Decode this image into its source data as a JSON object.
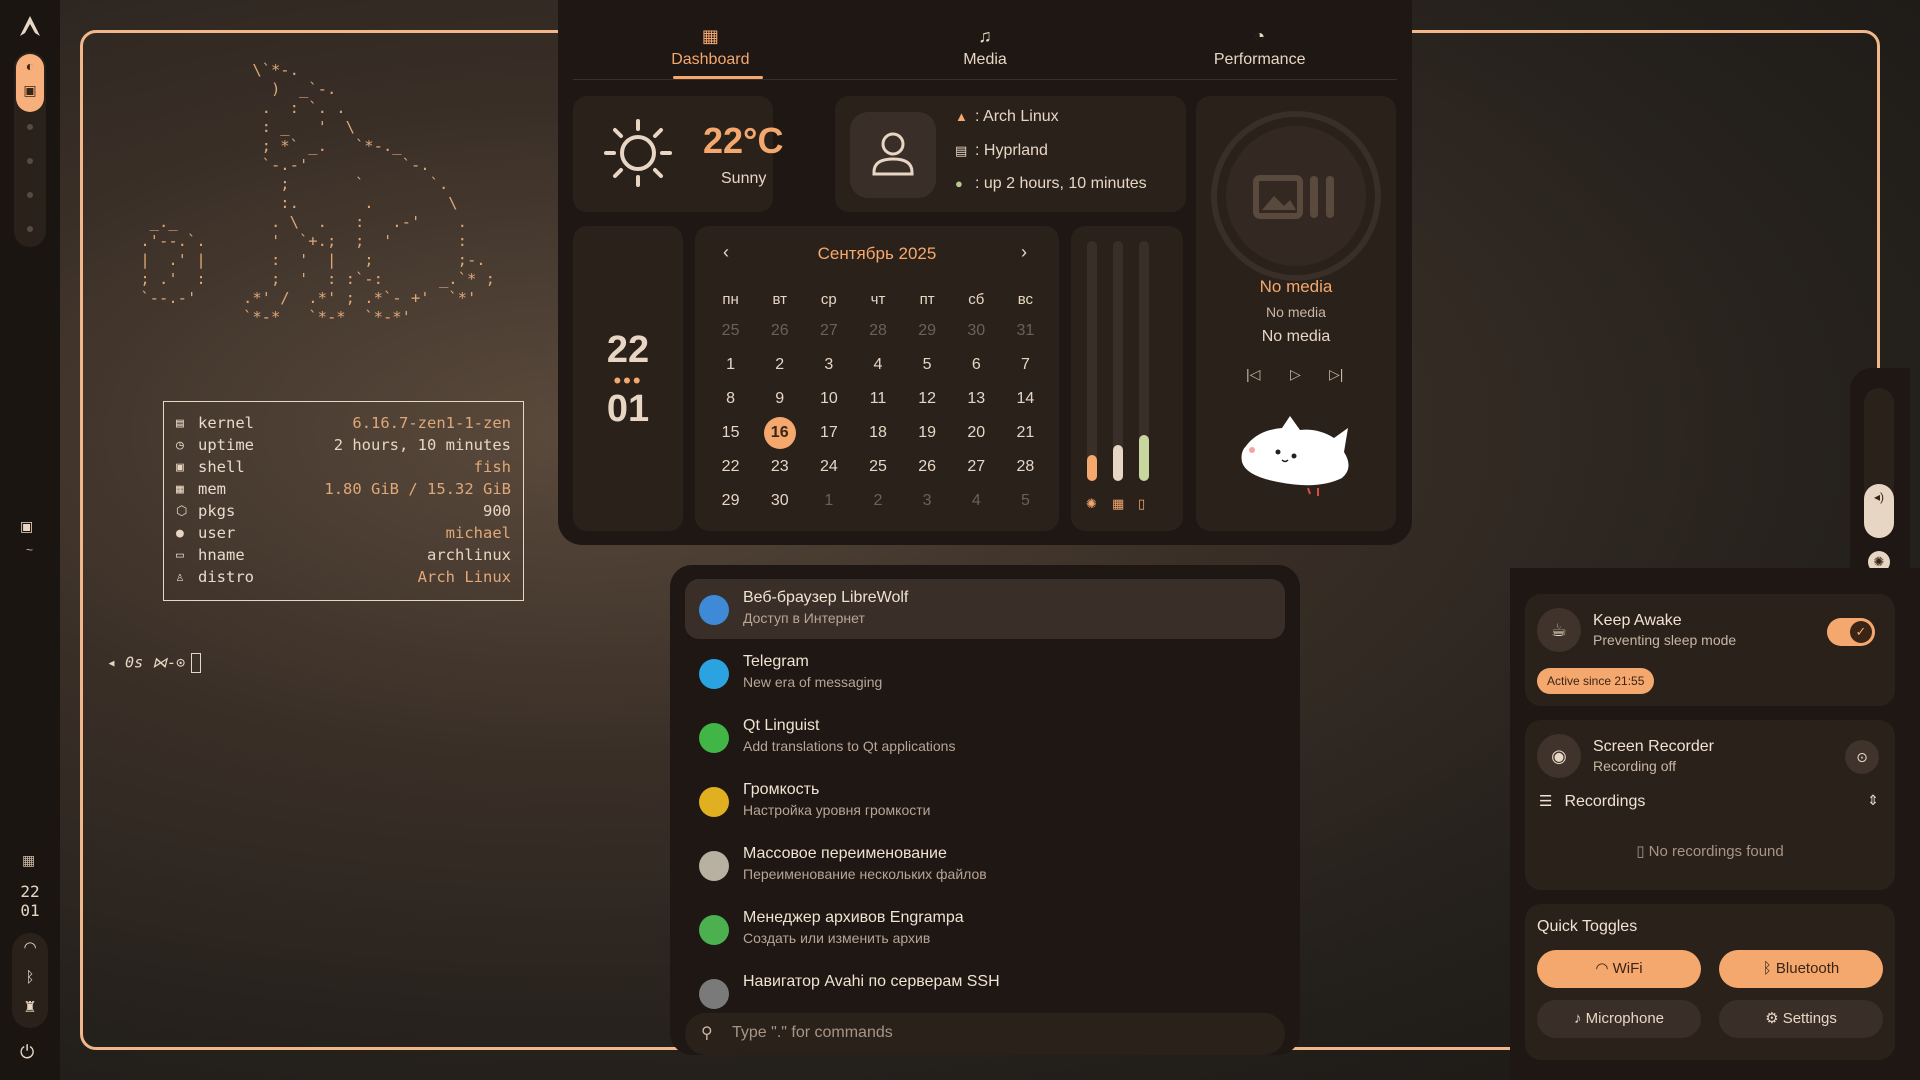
{
  "colors": {
    "accent": "#f5a86e",
    "bg_panel": "#1e1713",
    "card": "#2a211b",
    "text": "#e8d6c4"
  },
  "bar": {
    "logo_icon": "arch-logo-icon",
    "time_hour": "22",
    "time_minute": "01",
    "term_tilde": "~"
  },
  "terminal": {
    "fetch": [
      {
        "icon": "cpu-icon",
        "key": "kernel",
        "value": "6.16.7-zen1-1-zen",
        "accent": true
      },
      {
        "icon": "clock-icon",
        "key": "uptime",
        "value": "2 hours, 10 minutes",
        "accent": false
      },
      {
        "icon": "terminal-icon",
        "key": "shell",
        "value": "fish",
        "accent": true
      },
      {
        "icon": "memory-icon",
        "key": "mem",
        "value": "1.80 GiB / 15.32 GiB",
        "accent": true
      },
      {
        "icon": "package-icon",
        "key": "pkgs",
        "value": "900",
        "accent": false
      },
      {
        "icon": "user-icon",
        "key": "user",
        "value": "michael",
        "accent": true
      },
      {
        "icon": "monitor-icon",
        "key": "hname",
        "value": "archlinux",
        "accent": false
      },
      {
        "icon": "distro-icon",
        "key": "distro",
        "value": "Arch Linux",
        "accent": true
      }
    ],
    "prompt": "◂ 0s ⋈-⊙"
  },
  "dashboard": {
    "tabs": [
      {
        "label": "Dashboard",
        "icon": "grid-icon",
        "active": true
      },
      {
        "label": "Media",
        "icon": "playlist-icon",
        "active": false
      },
      {
        "label": "Performance",
        "icon": "gauge-icon",
        "active": false
      }
    ],
    "weather": {
      "temp": "22°C",
      "desc": "Sunny"
    },
    "system": {
      "os": "Arch Linux",
      "wm": "Hyprland",
      "uptime": "up 2 hours, 10 minutes"
    },
    "clock": {
      "hour": "22",
      "dots": "•••",
      "minute": "01"
    },
    "calendar": {
      "title": "Сентябрь 2025",
      "days_of_week": [
        "пн",
        "вт",
        "ср",
        "чт",
        "пт",
        "сб",
        "вс"
      ],
      "cells": [
        [
          "25",
          true
        ],
        [
          "26",
          true
        ],
        [
          "27",
          true
        ],
        [
          "28",
          true
        ],
        [
          "29",
          true
        ],
        [
          "30",
          true
        ],
        [
          "31",
          true
        ],
        [
          "1",
          false
        ],
        [
          "2",
          false
        ],
        [
          "3",
          false
        ],
        [
          "4",
          false
        ],
        [
          "5",
          false
        ],
        [
          "6",
          false
        ],
        [
          "7",
          false
        ],
        [
          "8",
          false
        ],
        [
          "9",
          false
        ],
        [
          "10",
          false
        ],
        [
          "11",
          false
        ],
        [
          "12",
          false
        ],
        [
          "13",
          false
        ],
        [
          "14",
          false
        ],
        [
          "15",
          false
        ],
        [
          "16",
          false
        ],
        [
          "17",
          false
        ],
        [
          "18",
          false
        ],
        [
          "19",
          false
        ],
        [
          "20",
          false
        ],
        [
          "21",
          false
        ],
        [
          "22",
          false
        ],
        [
          "23",
          false
        ],
        [
          "24",
          false
        ],
        [
          "25",
          false
        ],
        [
          "26",
          false
        ],
        [
          "27",
          false
        ],
        [
          "28",
          false
        ],
        [
          "29",
          false
        ],
        [
          "30",
          false
        ],
        [
          "1",
          true
        ],
        [
          "2",
          true
        ],
        [
          "3",
          true
        ],
        [
          "4",
          true
        ],
        [
          "5",
          true
        ]
      ],
      "today": "16"
    },
    "sliders": [
      {
        "icon": "brightness-icon",
        "level": 0.06,
        "color": "#f5a86e"
      },
      {
        "icon": "memory-icon",
        "level": 0.1,
        "color": "#e8d6c4"
      },
      {
        "icon": "battery-icon",
        "level": 0.14,
        "color": "#c8d6a0"
      }
    ],
    "media": {
      "title": "No media",
      "artist": "No media",
      "album": "No media"
    }
  },
  "launcher": {
    "apps": [
      {
        "name": "Веб-браузер LibreWolf",
        "desc": "Доступ в Интернет",
        "color": "#3f8ad6",
        "icon": "librewolf-icon"
      },
      {
        "name": "Telegram",
        "desc": "New era of messaging",
        "color": "#2aa3e0",
        "icon": "telegram-icon"
      },
      {
        "name": "Qt Linguist",
        "desc": "Add translations to Qt applications",
        "color": "#41b545",
        "icon": "qt-linguist-icon"
      },
      {
        "name": "Громкость",
        "desc": "Настройка уровня громкости",
        "color": "#e0b020",
        "icon": "volume-app-icon"
      },
      {
        "name": "Массовое переименование",
        "desc": "Переименование нескольких файлов",
        "color": "#b8b0a0",
        "icon": "bulk-rename-icon"
      },
      {
        "name": "Менеджер архивов Engrampa",
        "desc": "Создать или изменить архив",
        "color": "#4caf50",
        "icon": "archive-icon"
      },
      {
        "name": "Навигатор Avahi по серверам SSH",
        "desc": "",
        "color": "#7a7a7a",
        "icon": "ssh-icon"
      }
    ],
    "search_placeholder": "Type \".\" for commands"
  },
  "right": {
    "keep_awake": {
      "title": "Keep Awake",
      "sub": "Preventing sleep mode",
      "badge": "Active since 21:55",
      "on": true
    },
    "recorder": {
      "title": "Screen Recorder",
      "sub": "Recording off",
      "list_label": "Recordings",
      "empty": "No recordings found"
    },
    "quick_toggles": {
      "title": "Quick Toggles",
      "buttons": [
        {
          "label": "WiFi",
          "icon": "wifi-icon",
          "on": true
        },
        {
          "label": "Bluetooth",
          "icon": "bluetooth-icon",
          "on": true
        },
        {
          "label": "Microphone",
          "icon": "microphone-icon",
          "on": false
        },
        {
          "label": "Settings",
          "icon": "gear-icon",
          "on": false
        }
      ]
    }
  }
}
